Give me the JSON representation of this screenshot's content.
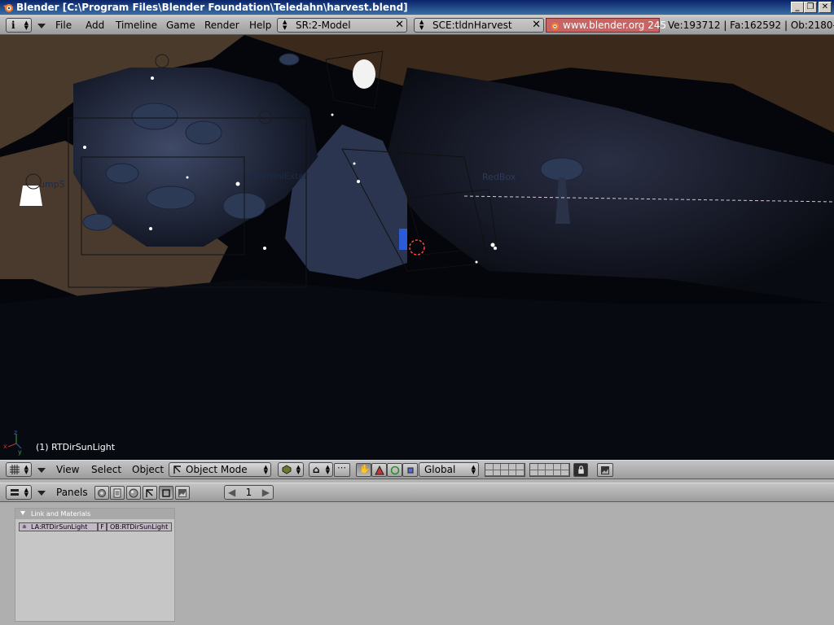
{
  "window": {
    "title": "Blender [C:\\Program Files\\Blender Foundation\\Teledahn\\harvest.blend]",
    "minimize": "_",
    "maximize": "❐",
    "close": "✕"
  },
  "info_header": {
    "info_icon": "i",
    "menus": [
      "File",
      "Add",
      "Timeline",
      "Game",
      "Render",
      "Help"
    ],
    "screen_field": "SR:2-Model",
    "scene_field": "SCE:tldnHarvest",
    "url": "www.blender.org 245",
    "stats": "Ve:193712 | Fa:162592 | Ob:2180-"
  },
  "viewport": {
    "object_label": "(1) RTDirSunLight",
    "scene_labels": {
      "left": "umpS",
      "center": "tewatrlnlExter",
      "right": "RedBox"
    }
  },
  "view3d_header": {
    "menus": [
      "View",
      "Select",
      "Object"
    ],
    "mode": "Object Mode",
    "orientation": "Global"
  },
  "buttons_header": {
    "panels_label": "Panels",
    "frame": "1"
  },
  "panel": {
    "title": "Link and Materials",
    "lamp_field": "LA:RTDirSunLight",
    "f_label": "F",
    "object_field": "OB:RTDirSunLight"
  },
  "colors": {
    "title_bar": "#0a246a",
    "header": "#b0b0b0",
    "viewport_bg": "#05070c",
    "url_field": "#c86464"
  }
}
